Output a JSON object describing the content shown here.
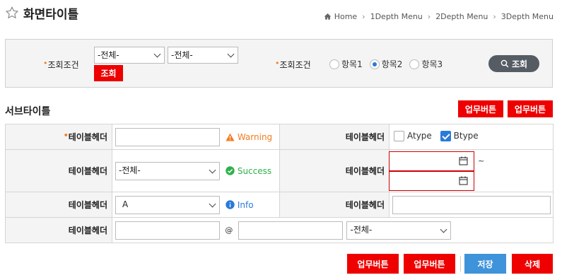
{
  "header": {
    "title": "화면타이틀",
    "breadcrumb": [
      "Home",
      "1Depth Menu",
      "2Depth Menu",
      "3Depth Menu"
    ]
  },
  "search": {
    "label1": "조회조건",
    "select1": "-전체-",
    "select2": "-전체-",
    "inline_button": "조회",
    "label2": "조회조건",
    "radios": [
      "항목1",
      "항목2",
      "항목3"
    ],
    "radio_selected": "항목2",
    "search_button": "조회"
  },
  "section": {
    "subtitle": "서브타이틀",
    "buttons": [
      "업무버튼",
      "업무버튼"
    ]
  },
  "form": {
    "header_label": "테이블헤더",
    "row1": {
      "status": "Warning",
      "checkboxes": [
        "Atype",
        "Btype"
      ],
      "checked": [
        "Btype"
      ]
    },
    "row2": {
      "select": "-전체-",
      "status": "Success",
      "range_sep": "~"
    },
    "row3": {
      "select": "A",
      "status": "Info"
    },
    "row4": {
      "at": "@",
      "select": "-전체-"
    }
  },
  "footer": {
    "buttons": [
      "업무버튼",
      "업무버튼"
    ],
    "save": "저장",
    "delete": "삭제"
  },
  "colors": {
    "red": "#ee0000",
    "blue": "#3e93da",
    "warning": "#f47b20",
    "success": "#2db24a",
    "info": "#2a7ad9",
    "dark": "#555c63"
  }
}
